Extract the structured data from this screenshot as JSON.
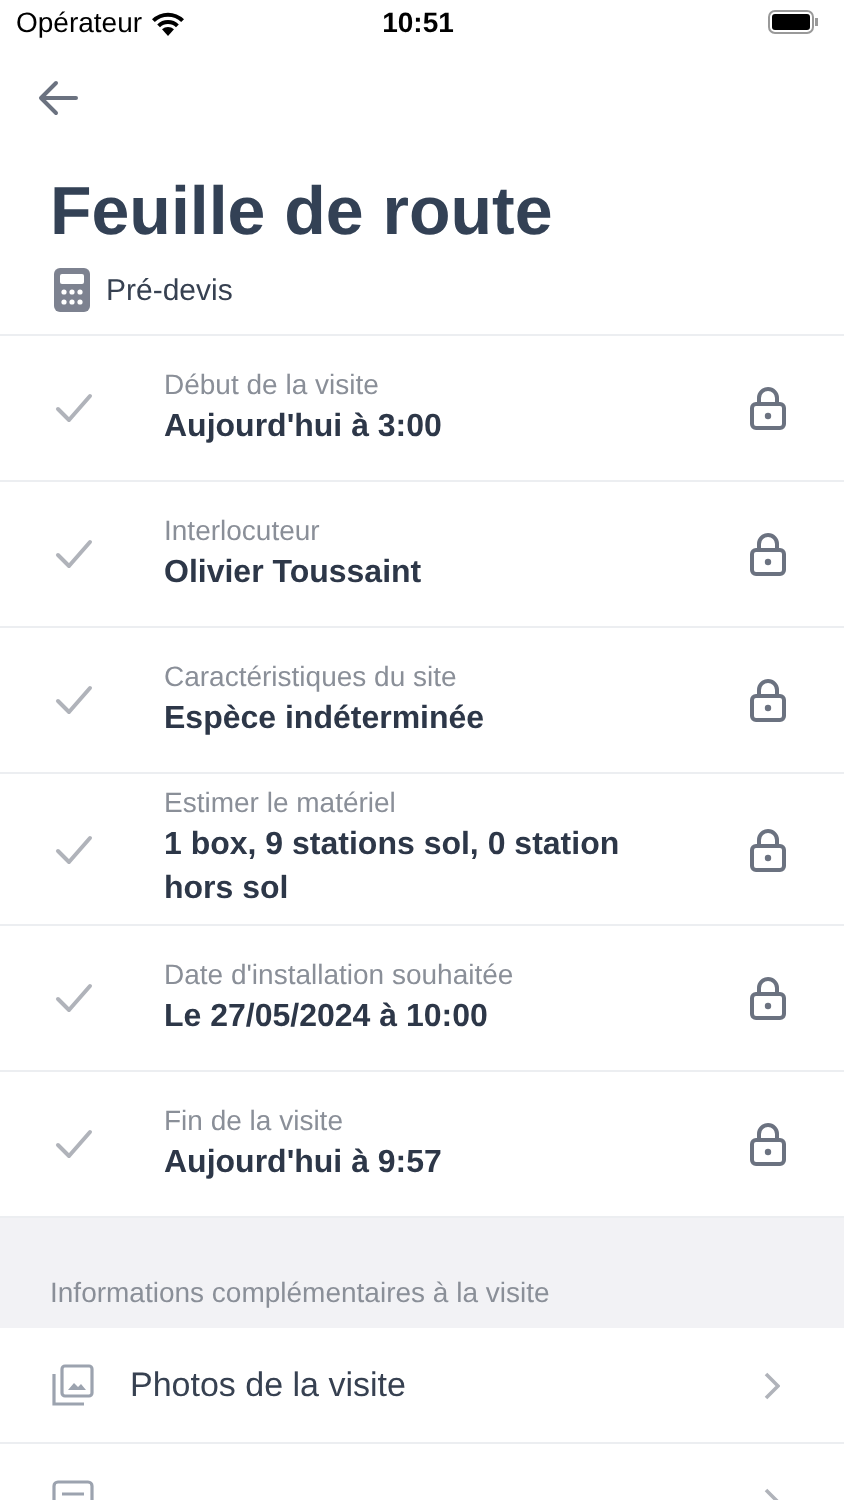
{
  "status_bar": {
    "carrier": "Opérateur",
    "time": "10:51"
  },
  "title": "Feuille de route",
  "subtitle": "Pré-devis",
  "steps": [
    {
      "label": "Début de la visite",
      "value": "Aujourd'hui à 3:00",
      "checked": true,
      "locked": true
    },
    {
      "label": "Interlocuteur",
      "value": "Olivier Toussaint",
      "checked": true,
      "locked": true
    },
    {
      "label": "Caractéristiques du site",
      "value": "Espèce indéterminée",
      "checked": true,
      "locked": true
    },
    {
      "label": "Estimer le matériel",
      "value": "1 box, 9 stations sol, 0 station hors sol",
      "checked": true,
      "locked": true
    },
    {
      "label": "Date d'installation souhaitée",
      "value": "Le 27/05/2024 à 10:00",
      "checked": true,
      "locked": true
    },
    {
      "label": "Fin de la visite",
      "value": "Aujourd'hui à 9:57",
      "checked": true,
      "locked": true
    }
  ],
  "section": {
    "header": "Informations complémentaires à la visite",
    "items": [
      {
        "kind": "photos",
        "label": "Photos de la visite"
      },
      {
        "kind": "notes"
      }
    ]
  }
}
